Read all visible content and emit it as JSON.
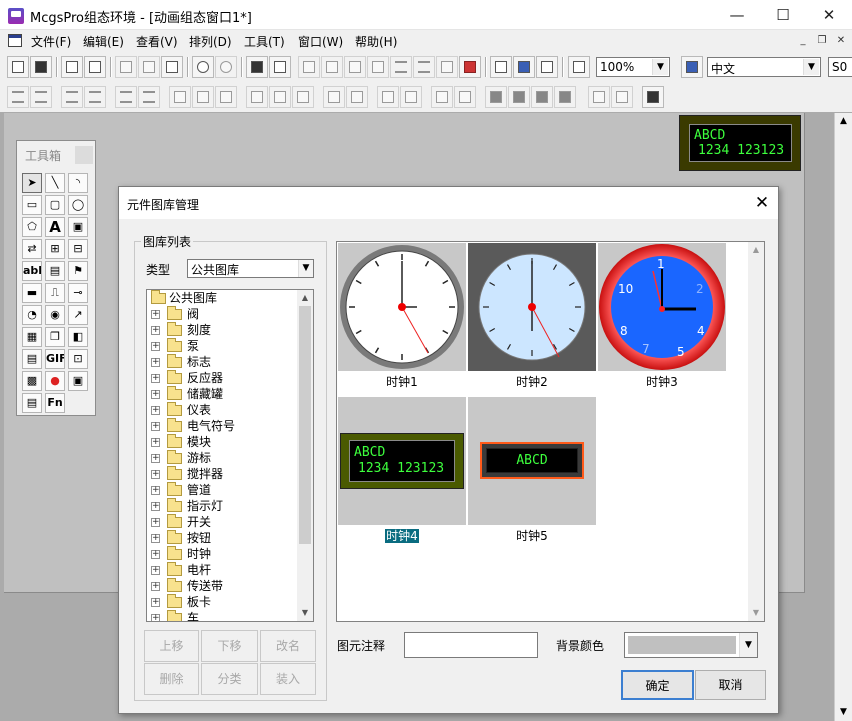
{
  "window": {
    "title": "McgsPro组态环境 - [动画组态窗口1*]",
    "minimize": "—",
    "maximize": "☐",
    "close": "✕"
  },
  "menu": [
    "文件(F)",
    "编辑(E)",
    "查看(V)",
    "排列(D)",
    "工具(T)",
    "窗口(W)",
    "帮助(H)"
  ],
  "mdi_controls": {
    "minimize": "_",
    "restore": "❐",
    "close": "✕"
  },
  "toolbar1": {
    "zoom": "100%",
    "language": "中文",
    "extra": "S0"
  },
  "toolbox": {
    "title": "工具箱",
    "tools": [
      "pointer-tool",
      "line-tool",
      "arc-tool",
      "rectangle-tool",
      "rounded-rect-tool",
      "ellipse-tool",
      "polygon-tool",
      "text-tool",
      "bitmap-tool",
      "flow-tool",
      "insert-element-tool",
      "save-element-tool",
      "input-box-tool",
      "label-tool",
      "alarm-tool",
      "standard-button-tool",
      "dynamic-button-tool",
      "slider-tool",
      "knob-tool",
      "indicator-tool",
      "trend-tool",
      "table-tool",
      "custom-window-tool",
      "chart-tool",
      "report-tool",
      "gif-tool",
      "combo-tool",
      "qrcode-tool",
      "alarm-light-tool",
      "alarm-bar-tool",
      "history-table-tool",
      "function-tool"
    ],
    "labels": {
      "text": "A",
      "input": "abl",
      "gif": "GIF",
      "fn": "Fn"
    }
  },
  "canvas_widget": {
    "line1": "ABCD",
    "line2": "1234 123123"
  },
  "dialog": {
    "title": "元件图库管理",
    "group_label": "图库列表",
    "type_label": "类型",
    "type_value": "公共图库",
    "tree": {
      "root": "公共图库",
      "items": [
        "阀",
        "刻度",
        "泵",
        "标志",
        "反应器",
        "储藏罐",
        "仪表",
        "电气符号",
        "模块",
        "游标",
        "搅拌器",
        "管道",
        "指示灯",
        "开关",
        "按钮",
        "时钟",
        "电杆",
        "传送带",
        "板卡",
        "车"
      ]
    },
    "buttons": {
      "move_up": "上移",
      "move_down": "下移",
      "rename": "改名",
      "delete": "删除",
      "classify": "分类",
      "load": "装入",
      "ok": "确定",
      "cancel": "取消"
    },
    "gallery": [
      {
        "caption": "时钟1",
        "selected": false
      },
      {
        "caption": "时钟2",
        "selected": false
      },
      {
        "caption": "时钟3",
        "selected": false
      },
      {
        "caption": "时钟4",
        "selected": true
      },
      {
        "caption": "时钟5",
        "selected": false
      }
    ],
    "clock3_numbers": [
      "1",
      "10",
      "2",
      "8",
      "4",
      "5",
      "7"
    ],
    "clock4": {
      "line1": "ABCD",
      "line2": "1234 123123"
    },
    "clock5": {
      "line1": "ABCD"
    },
    "note_label": "图元注释",
    "note_value": "",
    "bg_label": "背景颜色",
    "bg_color": "#c0c0c0"
  },
  "colors": {
    "lcd_text": "#3dff3d",
    "lcd_bg": "#000000",
    "selection": "#0a6c80",
    "clock3_face": "#1a66ff",
    "clock3_rim": "#e8202a"
  }
}
